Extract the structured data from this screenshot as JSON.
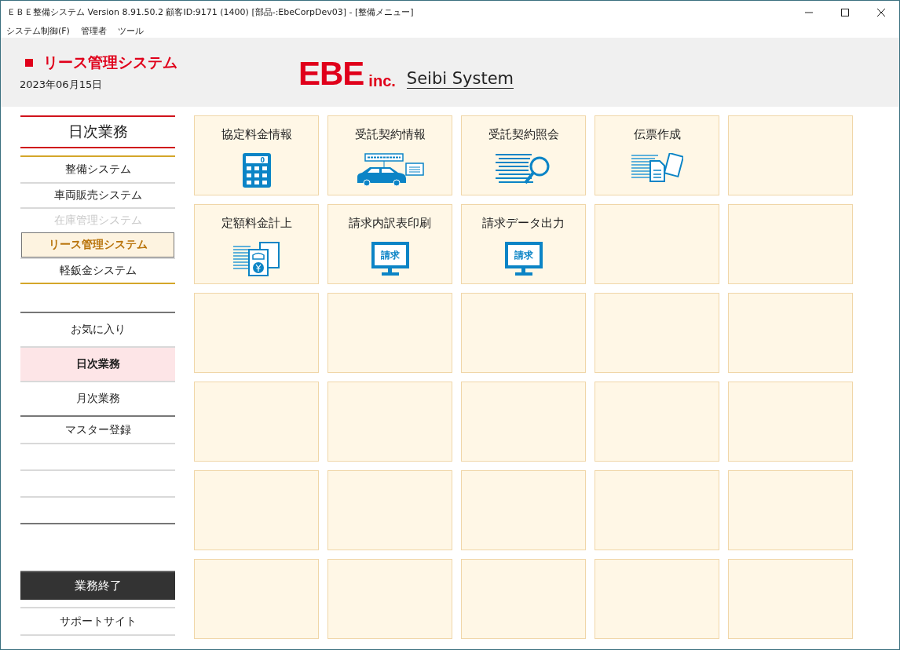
{
  "window": {
    "title": "ＥＢＥ整備システム Version 8.91.50.2 顧客ID:9171  (1400) [部品-:EbeCorpDev03] - [整備メニュー]"
  },
  "menu_bar": [
    "システム制御(F)",
    "管理者",
    "ツール"
  ],
  "header": {
    "system_name": "リース管理システム",
    "date": "2023年06月15日",
    "logo_main": "EBE",
    "logo_suffix": "inc.",
    "subtitle": "Seibi System"
  },
  "sidebar": {
    "section_title": "日次業務",
    "systems": [
      {
        "label": "整備システム",
        "selected": false,
        "disabled": false
      },
      {
        "label": "車両販売システム",
        "selected": false,
        "disabled": false
      },
      {
        "label": "在庫管理システム",
        "selected": false,
        "disabled": true
      },
      {
        "label": "リース管理システム",
        "selected": true,
        "disabled": false
      },
      {
        "label": "軽鈑金システム",
        "selected": false,
        "disabled": false
      }
    ],
    "menus": [
      {
        "label": "お気に入り",
        "selected": false
      },
      {
        "label": "日次業務",
        "selected": true
      },
      {
        "label": "月次業務",
        "selected": false
      },
      {
        "label": "マスター登録",
        "selected": false
      },
      {
        "kind": "blank"
      },
      {
        "kind": "blank"
      },
      {
        "kind": "blank"
      }
    ],
    "exit_button": "業務終了",
    "support_link": "サポートサイト"
  },
  "tiles": [
    {
      "label": "協定料金情報",
      "kind": "calculator",
      "icon_text": "0"
    },
    {
      "label": "受託契約情報",
      "kind": "car"
    },
    {
      "label": "受託契約照会",
      "kind": "search"
    },
    {
      "label": "伝票作成",
      "kind": "documents"
    },
    {
      "kind": "empty"
    },
    {
      "label": "定額料金計上",
      "kind": "yen"
    },
    {
      "label": "請求内訳表印刷",
      "kind": "monitor",
      "icon_text": "請求"
    },
    {
      "label": "請求データ出力",
      "kind": "monitor",
      "icon_text": "請求"
    },
    {
      "kind": "empty"
    },
    {
      "kind": "empty"
    },
    {
      "kind": "empty"
    },
    {
      "kind": "empty"
    },
    {
      "kind": "empty"
    },
    {
      "kind": "empty"
    },
    {
      "kind": "empty"
    },
    {
      "kind": "empty"
    },
    {
      "kind": "empty"
    },
    {
      "kind": "empty"
    },
    {
      "kind": "empty"
    },
    {
      "kind": "empty"
    },
    {
      "kind": "empty"
    },
    {
      "kind": "empty"
    },
    {
      "kind": "empty"
    },
    {
      "kind": "empty"
    },
    {
      "kind": "empty"
    },
    {
      "kind": "empty"
    },
    {
      "kind": "empty"
    },
    {
      "kind": "empty"
    },
    {
      "kind": "empty"
    },
    {
      "kind": "empty"
    }
  ]
}
